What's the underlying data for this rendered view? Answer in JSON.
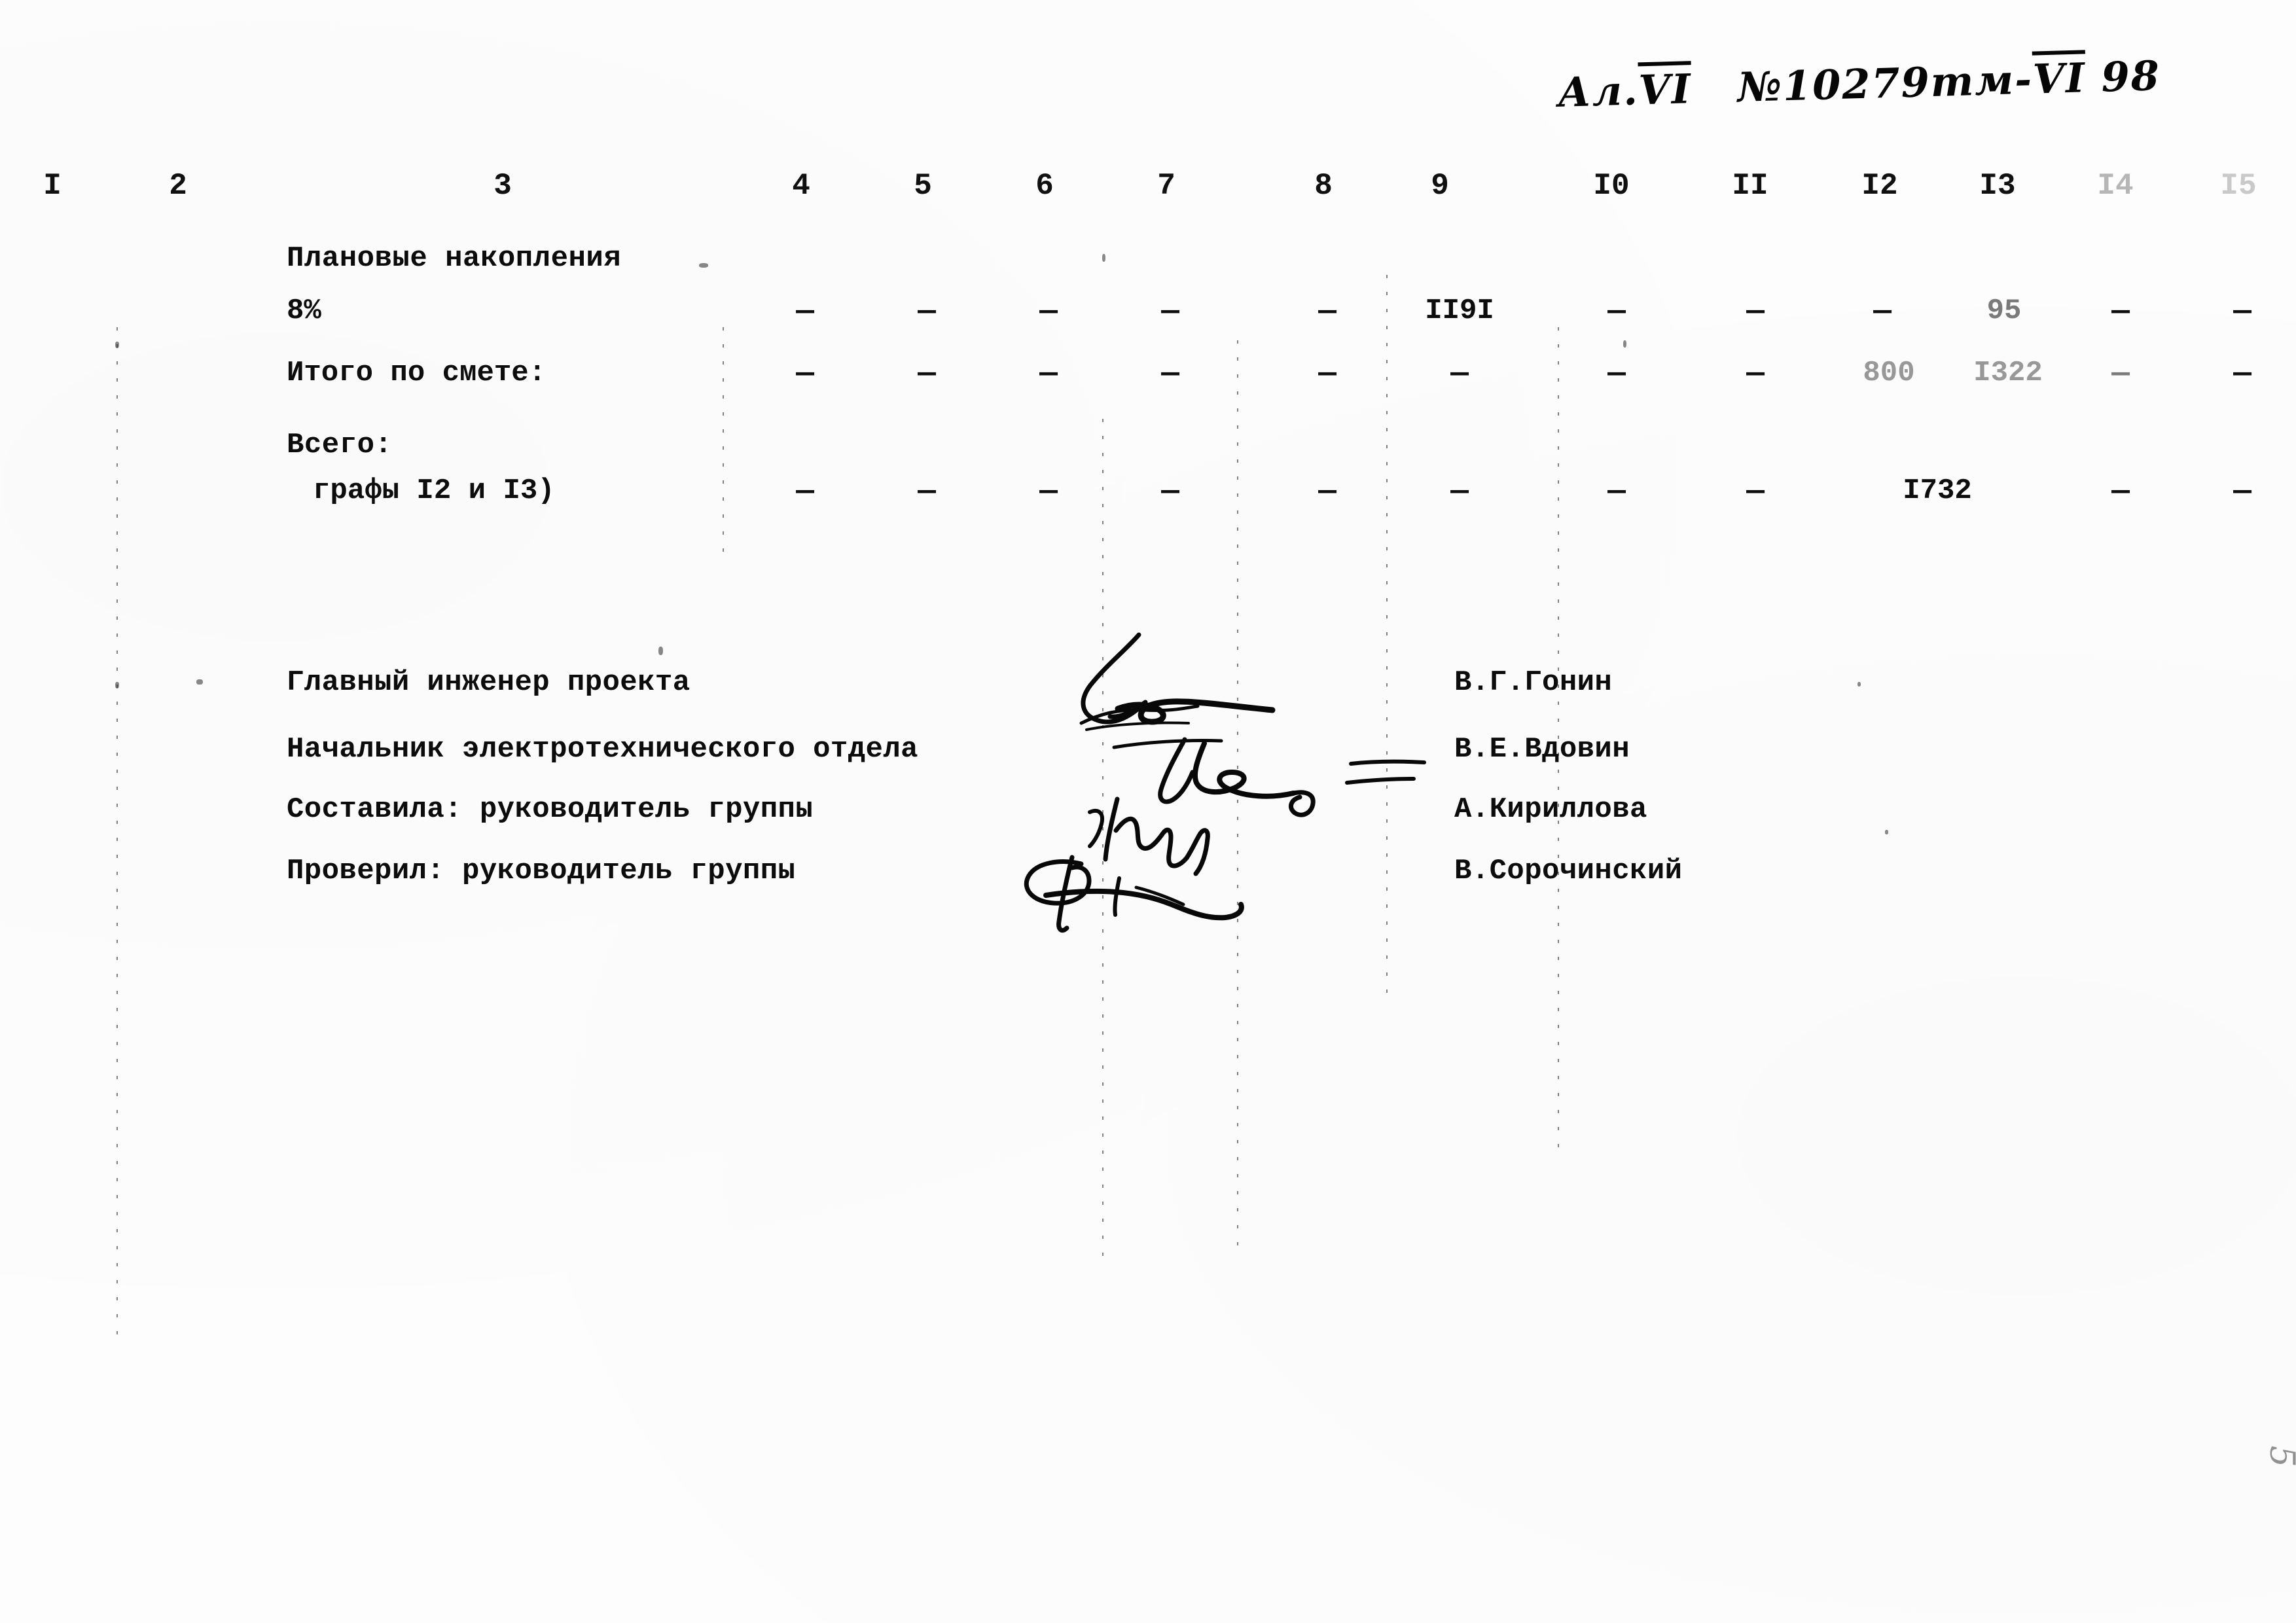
{
  "document": {
    "type": "smeta-continuation-sheet",
    "hand_header": {
      "sheet_prefix": "Ал.",
      "sheet_roman": "VI",
      "doc_number": "№10279тм-",
      "doc_roman": "VI",
      "doc_suffix": "98"
    },
    "page_number": "5"
  },
  "table": {
    "column_headers": [
      "I",
      "2",
      "3",
      "4",
      "5",
      "6",
      "7",
      "8",
      "9",
      "I0",
      "II",
      "I2",
      "I3",
      "I4",
      "I5"
    ],
    "dash": "—",
    "rows": [
      {
        "label_line1": "Плановые накопления",
        "label_line2": "8%",
        "values": {
          "c4": "—",
          "c5": "—",
          "c6": "—",
          "c7": "—",
          "c8": "—",
          "c9": "II9I",
          "c10": "—",
          "c11": "—",
          "c12": "—",
          "c13": "95",
          "c14": "—",
          "c15": "—"
        }
      },
      {
        "label_line1": "Итого по смете:",
        "label_line2": "",
        "values": {
          "c4": "—",
          "c5": "—",
          "c6": "—",
          "c7": "—",
          "c8": "—",
          "c9": "—",
          "c10": "—",
          "c11": "—",
          "c12": "800",
          "c13": "I322",
          "c14": "—",
          "c15": "—"
        }
      },
      {
        "label_line1": "Всего:",
        "label_line2": "графы I2 и I3)",
        "values": {
          "c4": "—",
          "c5": "—",
          "c6": "—",
          "c7": "—",
          "c8": "—",
          "c9": "—",
          "c10": "—",
          "c11": "—",
          "c12": "I732",
          "c13": "",
          "c14": "—",
          "c15": "—"
        }
      }
    ]
  },
  "signatures": [
    {
      "role": "Главный инженер проекта",
      "name": "В.Г.Гонин"
    },
    {
      "role": "Начальник электротехнического отдела",
      "name": "В.Е.Вдовин"
    },
    {
      "role": "Составила: руководитель группы",
      "name": "А.Кириллова"
    },
    {
      "role": "Проверил: руководитель группы",
      "name": "В.Сорочинский"
    }
  ],
  "colors": {
    "paper": "#fdfdfd",
    "ink": "#0a0a0a",
    "faded_ink": "#6b6b6b"
  }
}
